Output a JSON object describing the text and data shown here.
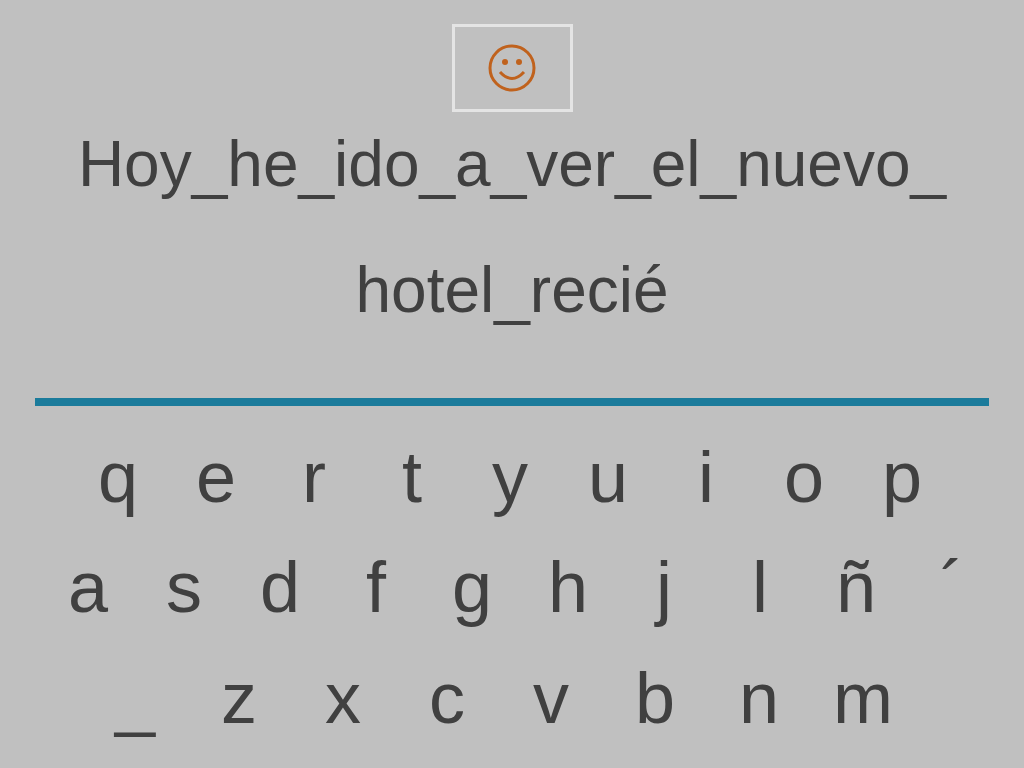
{
  "sentence_lines": [
    "Hoy_he_ido_a_ver_el_nuevo_",
    "hotel_recié"
  ],
  "keyboard_rows": [
    [
      "q",
      "e",
      "r",
      "t",
      "y",
      "u",
      "i",
      "o",
      "p"
    ],
    [
      "a",
      "s",
      "d",
      "f",
      "g",
      "h",
      "j",
      "l",
      "ñ",
      "´"
    ],
    [
      "_",
      "z",
      "x",
      "c",
      "v",
      "b",
      "n",
      "m"
    ]
  ]
}
